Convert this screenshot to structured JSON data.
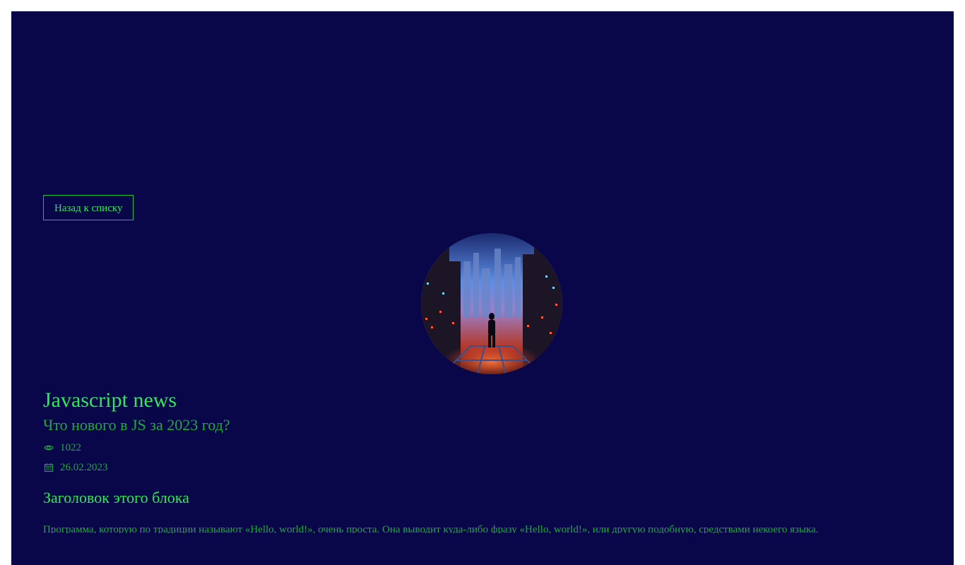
{
  "navigation": {
    "back_label": "Назад к списку"
  },
  "article": {
    "image_alt": "cyberpunk-city-illustration",
    "title": "Javascript news",
    "subtitle": "Что нового в JS за 2023 год?",
    "views": "1022",
    "date": "26.02.2023",
    "block_heading": "Заголовок этого блока",
    "paragraph": "Программа, которую по традиции называют «Hello, world!», очень проста. Она выводит куда-либо фразу «Hello, world!», или другую подобную, средствами некоего языка."
  },
  "icons": {
    "views": "eye-icon",
    "date": "calendar-icon"
  },
  "colors": {
    "background": "#0a064a",
    "accent": "#2ee85a",
    "accent_muted": "#1eab3c"
  }
}
